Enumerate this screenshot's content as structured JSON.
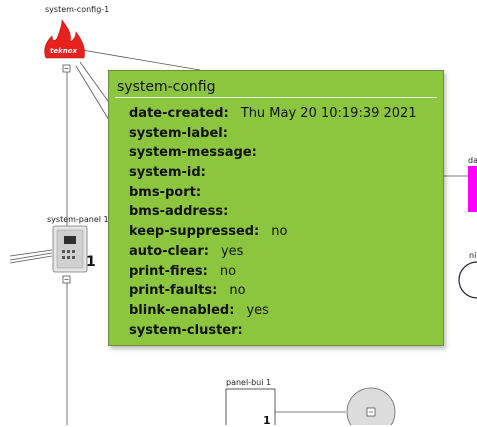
{
  "nodes": {
    "system_config_label": "system-config-1",
    "logo_text": "teknox",
    "system_panel_label": "system-panel 1",
    "system_panel_count": "1",
    "panel_bui_label": "panel-bui 1",
    "panel_bui_count": "1",
    "partial_label_right_1": "da",
    "partial_label_right_2": "ni",
    "accent_magenta": "#ff00ff",
    "logo_red": "#e8201e"
  },
  "tooltip": {
    "title": "system-config",
    "background": "#8cc63f",
    "rows": [
      {
        "key": "date-created:",
        "value": "Thu May 20 10:19:39 2021"
      },
      {
        "key": "system-label:",
        "value": ""
      },
      {
        "key": "system-message:",
        "value": ""
      },
      {
        "key": "system-id:",
        "value": ""
      },
      {
        "key": "bms-port:",
        "value": ""
      },
      {
        "key": "bms-address:",
        "value": ""
      },
      {
        "key": "keep-suppressed:",
        "value": "no"
      },
      {
        "key": "auto-clear:",
        "value": "yes"
      },
      {
        "key": "print-fires:",
        "value": "no"
      },
      {
        "key": "print-faults:",
        "value": "no"
      },
      {
        "key": "blink-enabled:",
        "value": "yes"
      },
      {
        "key": "system-cluster:",
        "value": ""
      }
    ]
  }
}
